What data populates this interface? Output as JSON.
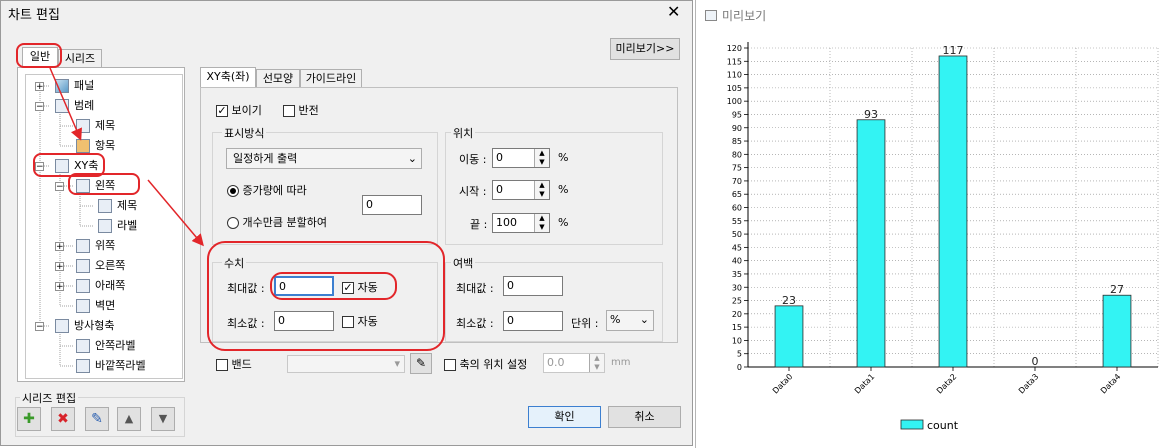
{
  "dialog": {
    "title": "차트 편집",
    "close": "✕",
    "tabs": [
      "일반",
      "시리즈"
    ],
    "preview_button": "미리보기>>",
    "tree": [
      {
        "label": "패널"
      },
      {
        "label": "범례"
      },
      {
        "label": "제목"
      },
      {
        "label": "항목"
      },
      {
        "label": "XY축"
      },
      {
        "label": "왼쪽"
      },
      {
        "label": "제목"
      },
      {
        "label": "라벨"
      },
      {
        "label": "위쪽"
      },
      {
        "label": "오른쪽"
      },
      {
        "label": "아래쪽"
      },
      {
        "label": "벽면"
      },
      {
        "label": "방사형축"
      },
      {
        "label": "안쪽라벨"
      },
      {
        "label": "바깥쪽라벨"
      }
    ],
    "series_edit": {
      "label": "시리즈 편집",
      "buttons": [
        {
          "name": "add",
          "glyph": "✚",
          "color": "#3a9a2a"
        },
        {
          "name": "delete",
          "glyph": "✖",
          "color": "#d8232a"
        },
        {
          "name": "edit",
          "glyph": "✎",
          "color": "#2a5fb0"
        },
        {
          "name": "move-up",
          "glyph": "▲",
          "color": "#555555"
        },
        {
          "name": "move-down",
          "glyph": "▼",
          "color": "#555555"
        }
      ]
    },
    "right_tabs": [
      "XY축(좌)",
      "선모양",
      "가이드라인"
    ],
    "show_label": "보이기",
    "show_checked": "✓",
    "reverse_label": "반전",
    "display_group": {
      "label": "표시방식",
      "dropdown_value": "일정하게 출력",
      "radio1": "증가량에 따라",
      "radio2": "개수만큼 분할하여",
      "interval_value": "0"
    },
    "position_group": {
      "label": "위치",
      "rows": [
        {
          "label": "이동 :",
          "value": "0",
          "unit": "%"
        },
        {
          "label": "시작 :",
          "value": "0",
          "unit": "%"
        },
        {
          "label": "끝 :",
          "value": "100",
          "unit": "%"
        }
      ]
    },
    "value_group": {
      "label": "수치",
      "max_label": "최대값 :",
      "max_value": "0",
      "min_label": "최소값 :",
      "min_value": "0",
      "auto_label": "자동",
      "auto_checked": "✓"
    },
    "margin_group": {
      "label": "여백",
      "max_label": "최대값 :",
      "max_value": "0",
      "min_label": "최소값 :",
      "min_value": "0",
      "unit_label": "단위 :",
      "unit_value": "%"
    },
    "band_label": "밴드",
    "axis_pos_label": "축의 위치 설정",
    "axis_pos_value": "0.0",
    "axis_pos_unit": "mm",
    "ok": "확인",
    "cancel": "취소"
  },
  "preview": {
    "title": "미리보기"
  },
  "chart_data": {
    "type": "bar",
    "categories": [
      "Data0",
      "Data1",
      "Data2",
      "Data3",
      "Data4"
    ],
    "series": [
      {
        "name": "count",
        "values": [
          23,
          93,
          117,
          0,
          27
        ],
        "color": "#33f3f3"
      }
    ],
    "ylim": [
      0,
      120
    ],
    "ytick_step": 5,
    "grid": true,
    "legend": "bottom"
  }
}
